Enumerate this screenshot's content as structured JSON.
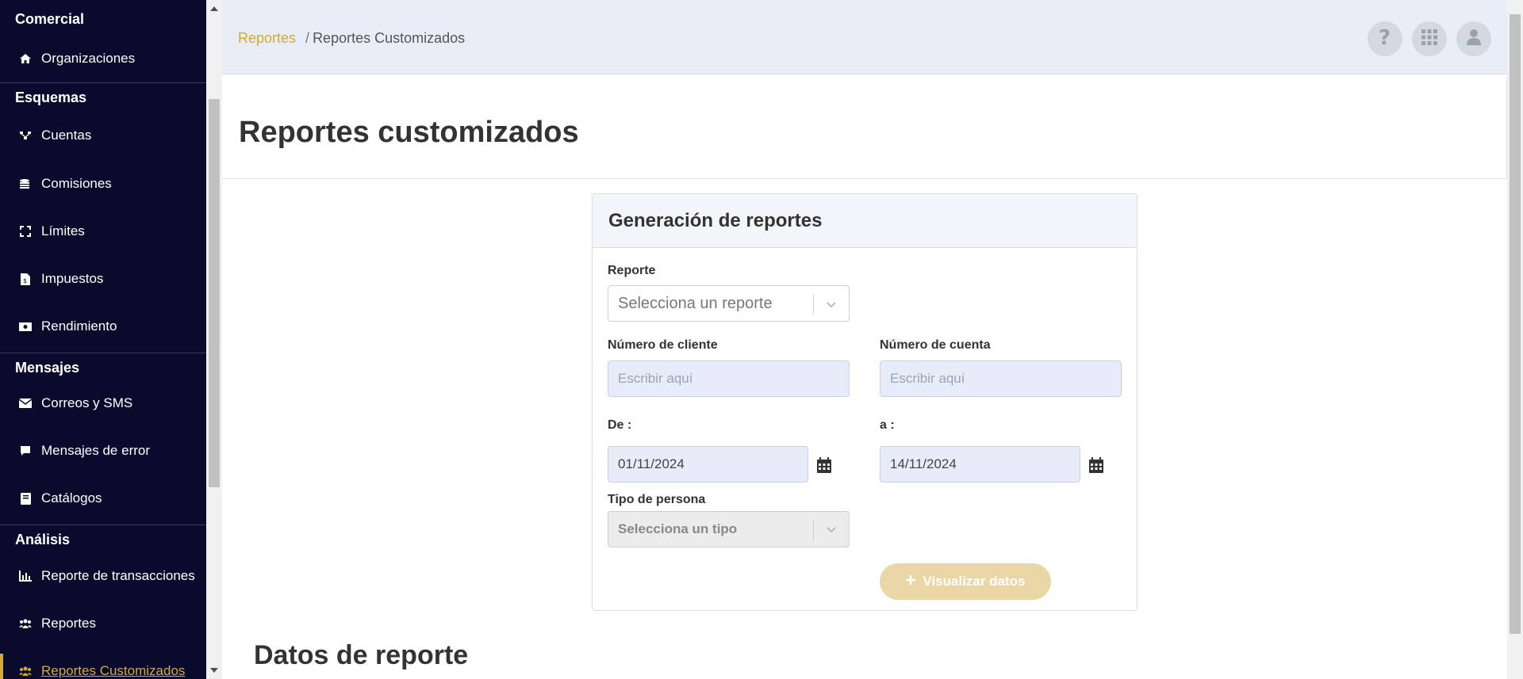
{
  "sidebar": {
    "sections": [
      {
        "title": "Comercial",
        "items": [
          {
            "label": "Organizaciones",
            "icon": "home-icon"
          }
        ]
      },
      {
        "title": "Esquemas",
        "items": [
          {
            "label": "Cuentas",
            "icon": "accounts-icon"
          },
          {
            "label": "Comisiones",
            "icon": "coins-icon"
          },
          {
            "label": "Límites",
            "icon": "expand-icon"
          },
          {
            "label": "Impuestos",
            "icon": "file-invoice-icon"
          },
          {
            "label": "Rendimiento",
            "icon": "money-bill-icon"
          }
        ]
      },
      {
        "title": "Mensajes",
        "items": [
          {
            "label": "Correos y SMS",
            "icon": "envelope-icon"
          },
          {
            "label": "Mensajes de error",
            "icon": "comment-icon"
          },
          {
            "label": "Catálogos",
            "icon": "book-icon"
          }
        ]
      },
      {
        "title": "Análisis",
        "items": [
          {
            "label": "Reporte de transacciones",
            "icon": "chart-bar-icon"
          },
          {
            "label": "Reportes",
            "icon": "users-icon"
          },
          {
            "label": "Reportes Customizados",
            "icon": "users-icon",
            "active": true
          }
        ]
      }
    ]
  },
  "header": {
    "breadcrumb_link": "Reportes",
    "breadcrumb_sep": "/",
    "breadcrumb_current": "Reportes Customizados"
  },
  "page": {
    "title": "Reportes customizados",
    "data_section_title": "Datos de reporte"
  },
  "form": {
    "card_title": "Generación de reportes",
    "report_label": "Reporte",
    "report_placeholder": "Selecciona un reporte",
    "client_label": "Número de cliente",
    "client_placeholder": "Escribir aquí",
    "account_label": "Número de cuenta",
    "account_placeholder": "Escribir aquí",
    "from_label": "De :",
    "from_value": "01/11/2024",
    "to_label": "a :",
    "to_value": "14/11/2024",
    "person_type_label": "Tipo de persona",
    "person_type_placeholder": "Selecciona un tipo",
    "submit_label": "Visualizar datos"
  },
  "colors": {
    "sidebar_bg": "#0a0a2c",
    "accent": "#d9a92d",
    "button_disabled": "#ead7a5",
    "header_bg": "#e9edf7"
  }
}
